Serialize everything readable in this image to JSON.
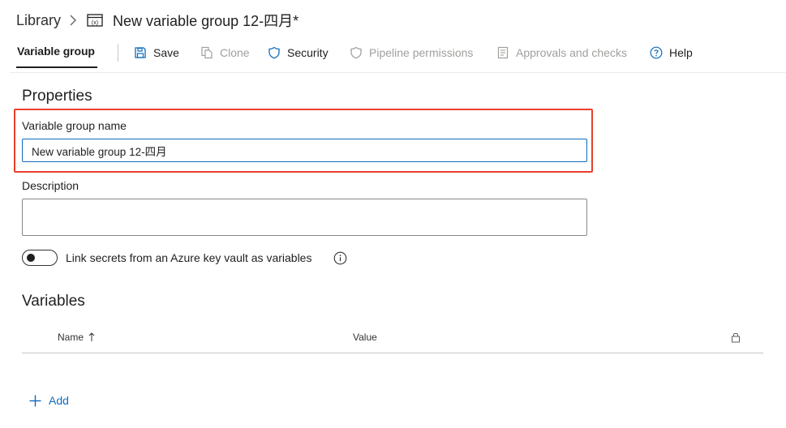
{
  "breadcrumb": {
    "root": "Library",
    "separator_icon": "chevron-right-icon",
    "group_icon": "variable-group-icon",
    "current": "New variable group 12-四月*"
  },
  "toolbar": {
    "active_tab": "Variable group",
    "buttons": [
      {
        "label": "Save",
        "icon": "save-icon",
        "enabled": true
      },
      {
        "label": "Clone",
        "icon": "clone-icon",
        "enabled": false
      },
      {
        "label": "Security",
        "icon": "shield-icon",
        "enabled": true
      },
      {
        "label": "Pipeline permissions",
        "icon": "shield-icon",
        "enabled": false
      },
      {
        "label": "Approvals and checks",
        "icon": "checklist-icon",
        "enabled": false
      },
      {
        "label": "Help",
        "icon": "help-icon",
        "enabled": true
      }
    ]
  },
  "properties": {
    "title": "Properties",
    "name_label": "Variable group name",
    "name_value": "New variable group 12-四月",
    "description_label": "Description",
    "description_value": "",
    "link_secrets_label": "Link secrets from an Azure key vault as variables",
    "link_secrets_enabled": false
  },
  "variables": {
    "title": "Variables",
    "columns": {
      "name": "Name",
      "name_sort_icon": "sort-ascending-icon",
      "value": "Value",
      "secret_icon": "lock-icon"
    },
    "rows": [],
    "add_label": "Add"
  },
  "colors": {
    "accent": "#0f6cbd",
    "highlight": "#e8412c",
    "disabled": "#a19f9d"
  }
}
